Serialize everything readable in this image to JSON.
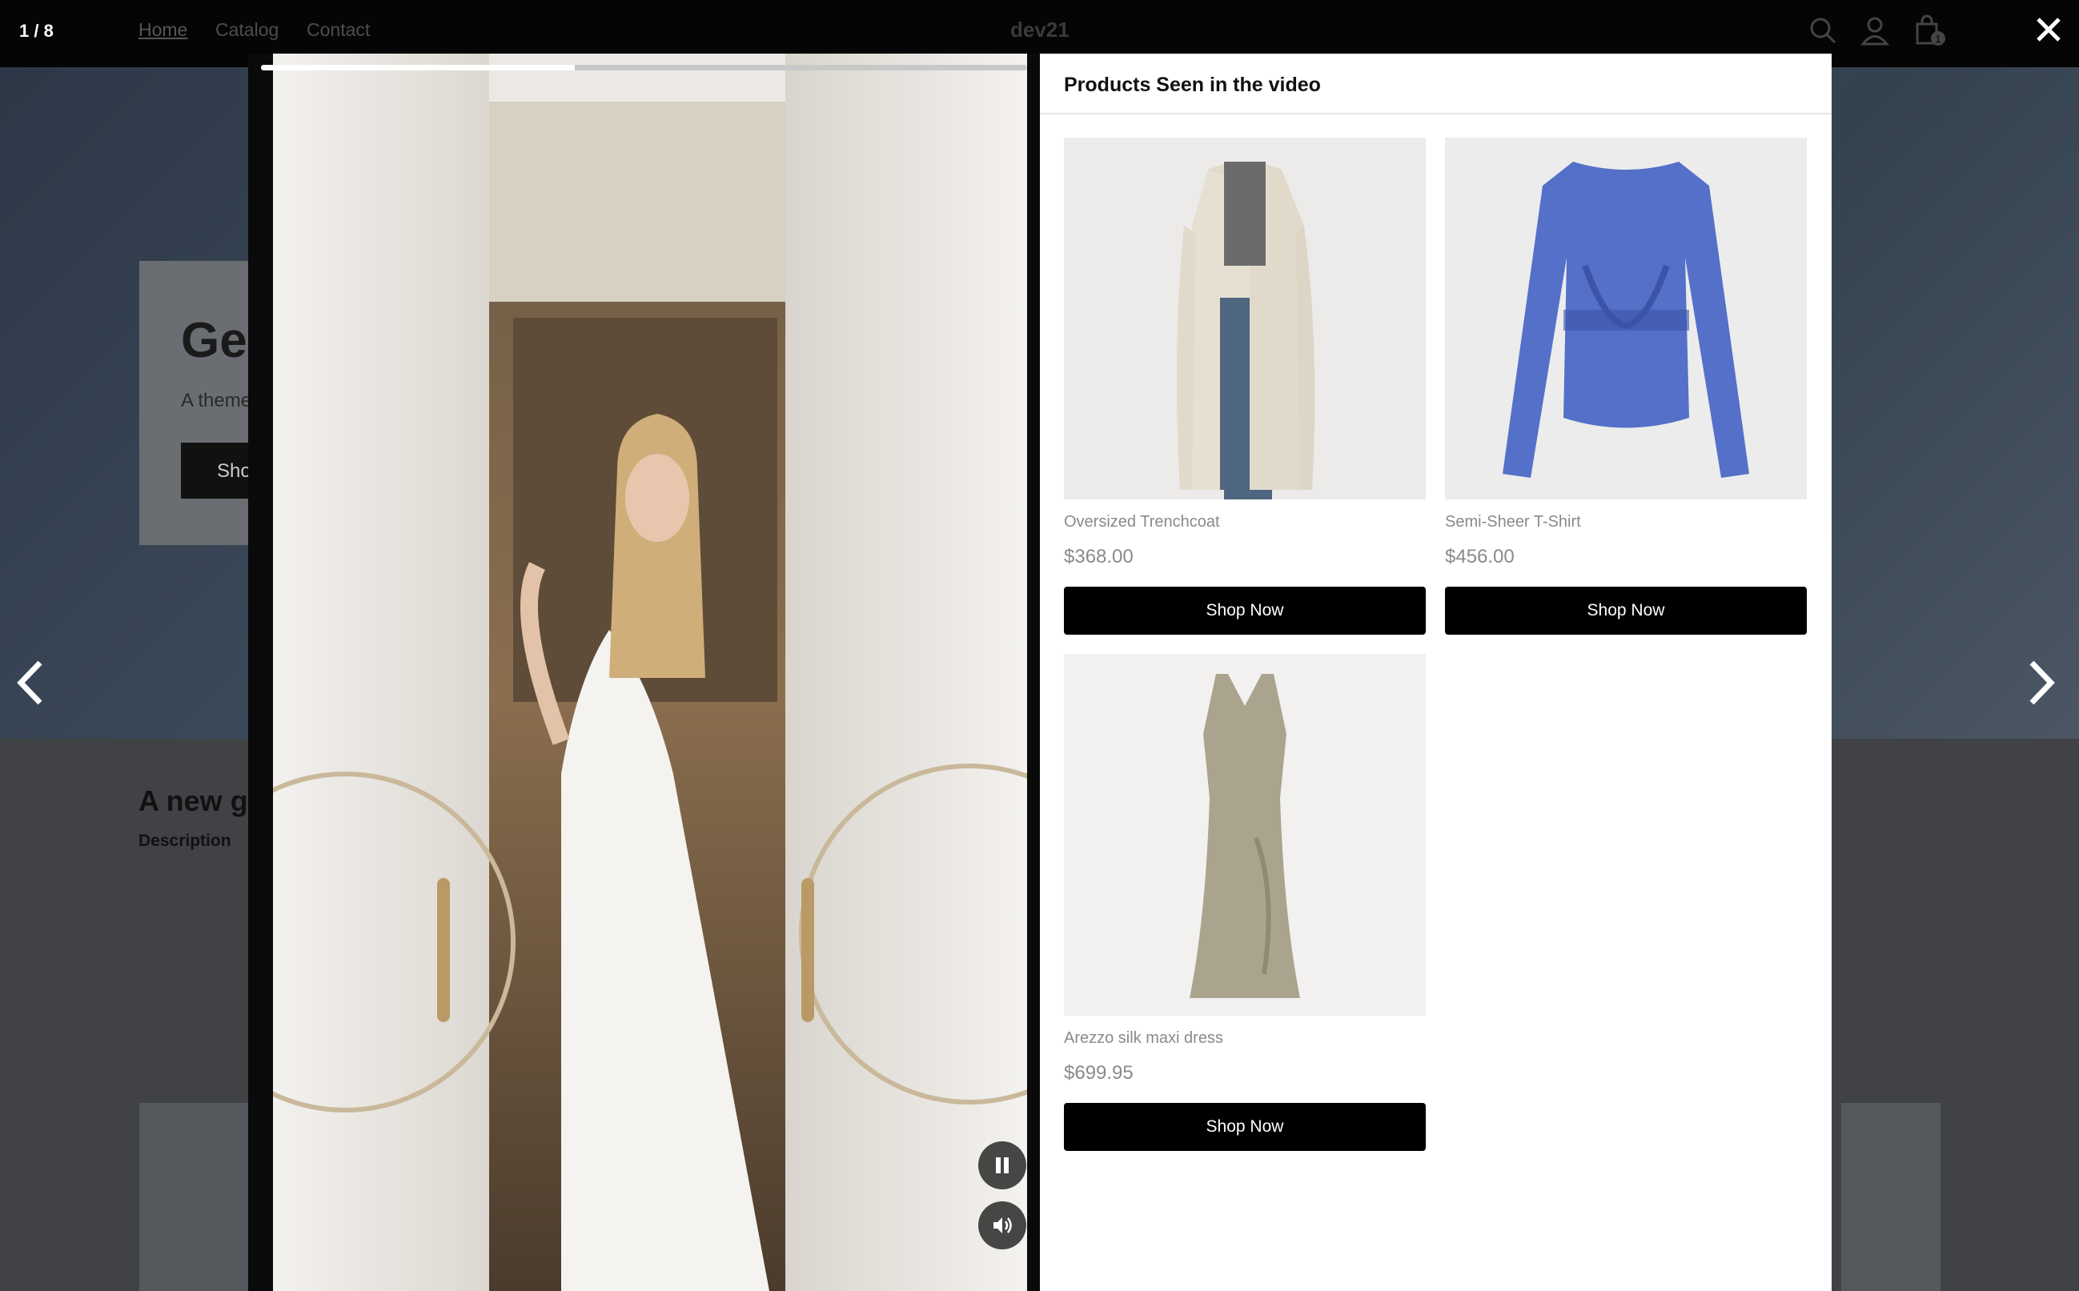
{
  "header": {
    "counter": "1 / 8",
    "nav": {
      "home": "Home",
      "catalog": "Catalog",
      "contact": "Contact"
    },
    "brand": "dev21",
    "cart_count": "1"
  },
  "background_page": {
    "hero_title": "Ge",
    "hero_subtitle": "A theme",
    "hero_button": "Sho",
    "section_title": "A new g",
    "section_desc": "Description"
  },
  "video": {
    "progress_fraction": 0.41
  },
  "panel": {
    "title": "Products Seen in the video",
    "products": [
      {
        "name": "Oversized Trenchcoat",
        "price": "$368.00",
        "button": "Shop Now"
      },
      {
        "name": "Semi-Sheer T-Shirt",
        "price": "$456.00",
        "button": "Shop Now"
      },
      {
        "name": "Arezzo silk maxi dress",
        "price": "$699.95",
        "button": "Shop Now"
      }
    ]
  },
  "icons": {
    "search": "search-icon",
    "account": "user-icon",
    "cart": "bag-icon",
    "close": "close-icon",
    "prev": "chevron-left-icon",
    "next": "chevron-right-icon",
    "pause": "pause-icon",
    "volume": "volume-icon"
  },
  "colors": {
    "overlay_bar": "#050505",
    "button": "#000000",
    "price_text": "#8a8a8a",
    "progress": "#ffffff"
  }
}
